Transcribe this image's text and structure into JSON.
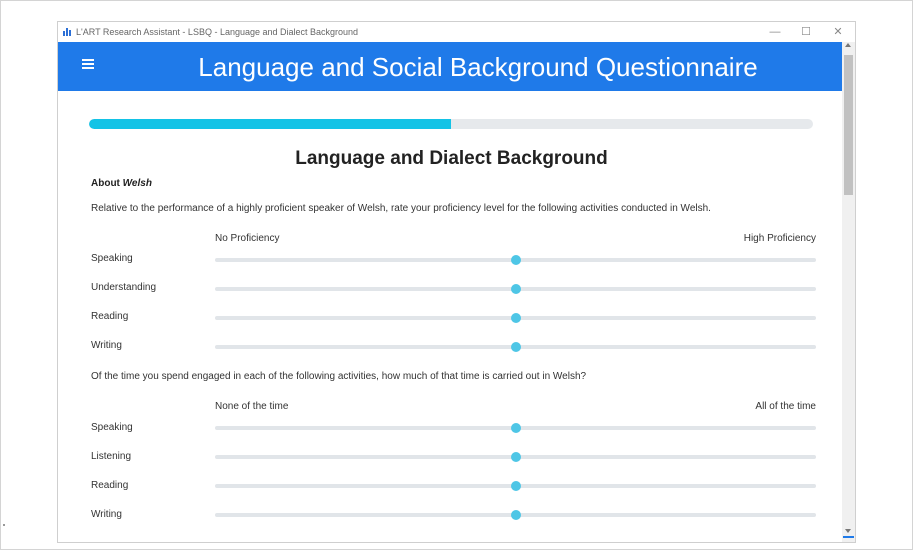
{
  "window": {
    "title": "L'ART Research Assistant - LSBQ - Language and Dialect Background",
    "controls": {
      "minimize": "—",
      "maximize": "☐",
      "close": "✕"
    }
  },
  "header": {
    "title": "Language and Social Background Questionnaire",
    "menu_icon": "hamburger-icon"
  },
  "progress": {
    "value": 0.5
  },
  "section": {
    "title": "Language and Dialect Background",
    "about_prefix": "About",
    "about_language": "Welsh"
  },
  "proficiency": {
    "question": "Relative to the performance of a highly proficient speaker of Welsh, rate your proficiency level for the following activities conducted in Welsh.",
    "min_label": "No Proficiency",
    "max_label": "High Proficiency",
    "items": [
      {
        "label": "Speaking",
        "value": 0.5
      },
      {
        "label": "Understanding",
        "value": 0.5
      },
      {
        "label": "Reading",
        "value": 0.5
      },
      {
        "label": "Writing",
        "value": 0.5
      }
    ]
  },
  "usage": {
    "question": "Of the time you spend engaged in each of the following activities, how much of that time is carried out in Welsh?",
    "min_label": "None of the time",
    "max_label": "All of the time",
    "items": [
      {
        "label": "Speaking",
        "value": 0.5
      },
      {
        "label": "Listening",
        "value": 0.5
      },
      {
        "label": "Reading",
        "value": 0.5
      },
      {
        "label": "Writing",
        "value": 0.5
      }
    ]
  },
  "colors": {
    "header": "#1f7ae9",
    "progress": "#13c3e6",
    "thumb": "#4ec6e6",
    "track": "#e1e5e9"
  }
}
